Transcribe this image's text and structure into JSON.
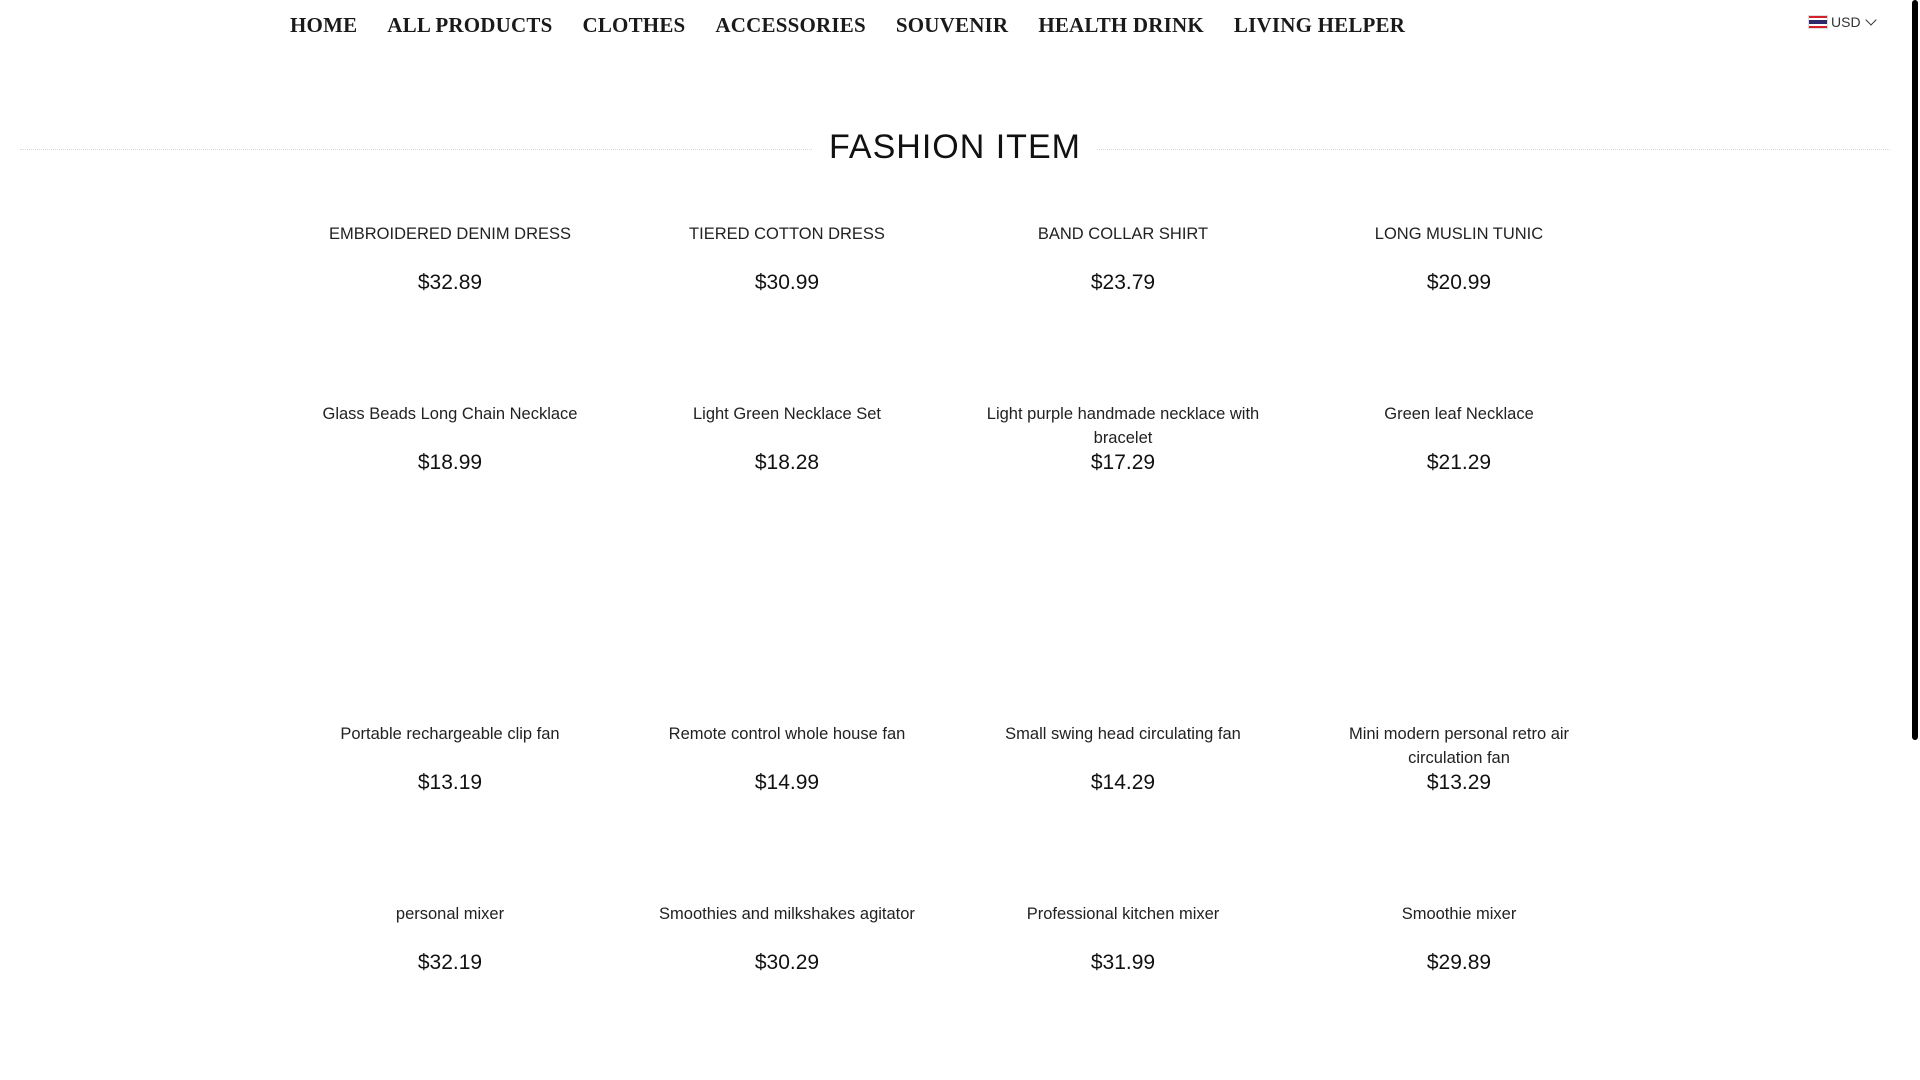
{
  "nav": {
    "items": [
      "HOME",
      "ALL PRODUCTS",
      "CLOTHES",
      "ACCESSORIES",
      "SOUVENIR",
      "HEALTH DRINK",
      "LIVING HELPER"
    ]
  },
  "currency": {
    "label": "USD",
    "flag_icon": "thailand-flag-icon"
  },
  "section": {
    "title": "FASHION ITEM"
  },
  "products": [
    {
      "name": "EMBROIDERED DENIM DRESS",
      "price": "$32.89"
    },
    {
      "name": "TIERED COTTON DRESS",
      "price": "$30.99"
    },
    {
      "name": "BAND COLLAR SHIRT",
      "price": "$23.79"
    },
    {
      "name": "LONG MUSLIN TUNIC",
      "price": "$20.99"
    },
    {
      "name": "Glass Beads Long Chain Necklace",
      "price": "$18.99"
    },
    {
      "name": "Light Green Necklace Set",
      "price": "$18.28"
    },
    {
      "name": "Light purple handmade necklace with bracelet",
      "price": "$17.29"
    },
    {
      "name": "Green leaf Necklace",
      "price": "$21.29"
    },
    {
      "name": "Portable rechargeable clip fan",
      "price": "$13.19"
    },
    {
      "name": "Remote control whole house fan",
      "price": "$14.99"
    },
    {
      "name": "Small swing head circulating fan",
      "price": "$14.29"
    },
    {
      "name": "Mini modern personal retro air circulation fan",
      "price": "$13.29"
    },
    {
      "name": "personal mixer",
      "price": "$32.19"
    },
    {
      "name": "Smoothies and milkshakes agitator",
      "price": "$30.29"
    },
    {
      "name": "Professional kitchen mixer",
      "price": "$31.99"
    },
    {
      "name": "Smoothie mixer",
      "price": "$29.89"
    }
  ]
}
